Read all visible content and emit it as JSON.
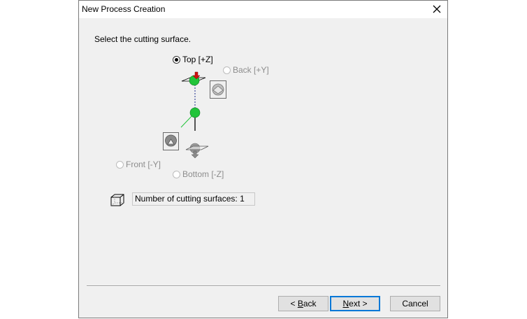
{
  "window": {
    "title": "New Process Creation"
  },
  "instruction": "Select the cutting surface.",
  "surfaces": {
    "top": {
      "label": "Top [+Z]",
      "selected": true,
      "enabled": true
    },
    "back": {
      "label": "Back [+Y]",
      "selected": false,
      "enabled": false
    },
    "front": {
      "label": "Front [-Y]",
      "selected": false,
      "enabled": false
    },
    "bottom": {
      "label": "Bottom [-Z]",
      "selected": false,
      "enabled": false
    }
  },
  "count_text": "Number of cutting surfaces: 1",
  "buttons": {
    "back": {
      "prefix": "< ",
      "mnemonic": "B",
      "rest": "ack"
    },
    "next": {
      "mnemonic": "N",
      "rest": "ext >"
    },
    "cancel": "Cancel"
  },
  "colors": {
    "sphere": "#22c43a",
    "arrow": "#d01010",
    "focus": "#0078d7"
  },
  "icons": [
    "close-icon",
    "top-surface-icon",
    "back-view-icon",
    "front-view-icon",
    "bottom-surface-icon",
    "box-3d-icon"
  ]
}
